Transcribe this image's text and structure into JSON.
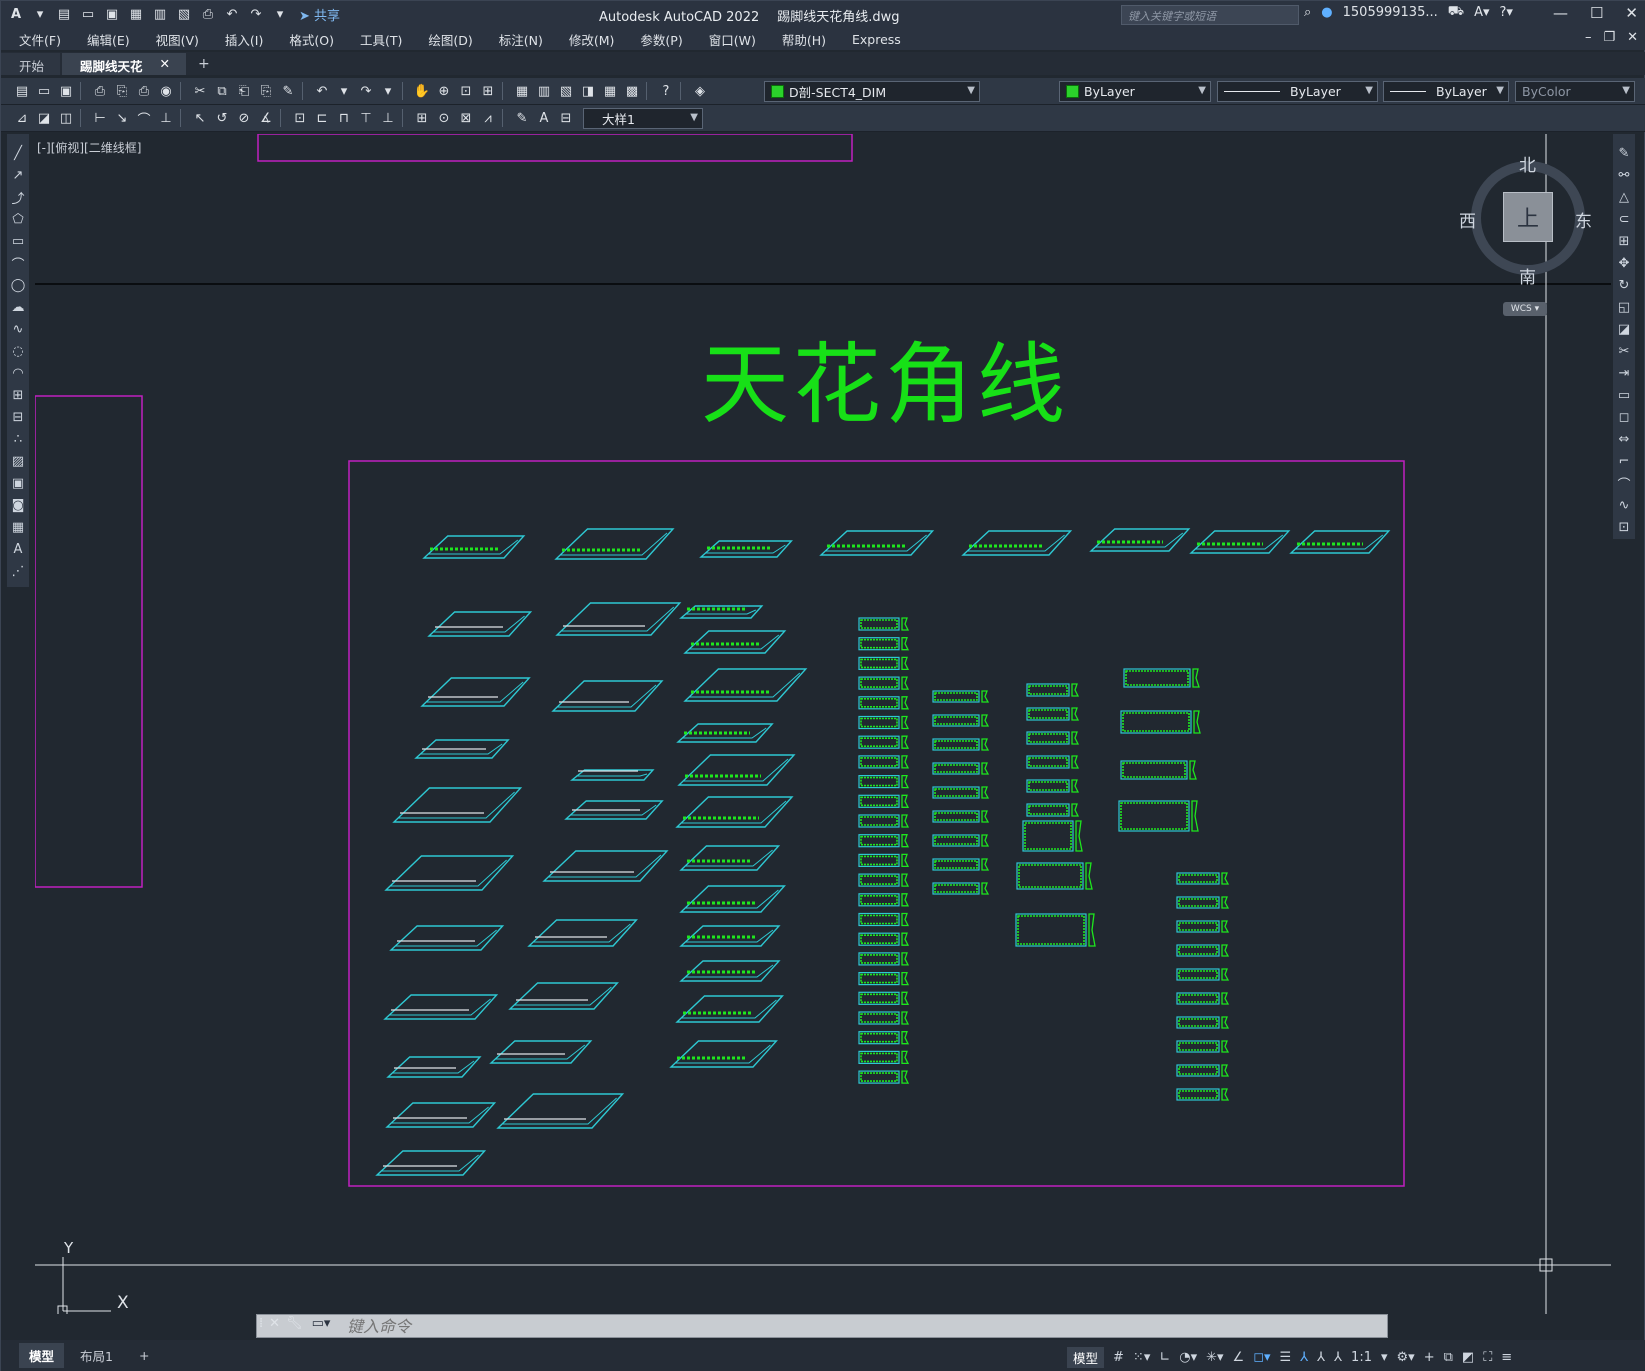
{
  "titlebar": {
    "app_title": "Autodesk AutoCAD 2022",
    "file_title": "踢脚线天花角线.dwg",
    "share_label": "共享",
    "search_placeholder": "键入关键字或短语",
    "user_name": "1505999135...",
    "min_icon": "minimize-icon",
    "max_icon": "maximize-icon",
    "close_icon": "close-icon"
  },
  "menu": {
    "items": [
      "文件(F)",
      "编辑(E)",
      "视图(V)",
      "插入(I)",
      "格式(O)",
      "工具(T)",
      "绘图(D)",
      "标注(N)",
      "修改(M)",
      "参数(P)",
      "窗口(W)",
      "帮助(H)",
      "Express"
    ]
  },
  "tabs": {
    "start_label": "开始",
    "active_label": "踢脚线天花角线*",
    "close_glyph": "✕",
    "add_glyph": "+"
  },
  "toolbar": {
    "layer_combo": "D剖-SECT4_DIM",
    "color_combo": "ByLayer",
    "linetype_combo": "ByLayer",
    "lineweight_combo": "ByLayer",
    "plotstyle_combo": "ByColor",
    "dimstyle_combo": "大样1"
  },
  "viewport": {
    "view_label": "[-][俯视][二维线框]",
    "compass_north": "北",
    "compass_south": "南",
    "compass_west": "西",
    "compass_east": "东",
    "cube_face": "上",
    "wcs_label": "WCS"
  },
  "drawing": {
    "title": "天花角线",
    "title_color": "#17e017",
    "frame_color": "#c020c0",
    "profile_color": "#2ec8d2",
    "detail_color": "#1ee61e"
  },
  "ucs": {
    "y_label": "Y",
    "x_label": "X"
  },
  "command": {
    "placeholder": "键入命令"
  },
  "status": {
    "model_tab": "模型",
    "layout_tab": "布局1",
    "add_tab": "+",
    "model_button": "模型",
    "scale": "1:1"
  }
}
